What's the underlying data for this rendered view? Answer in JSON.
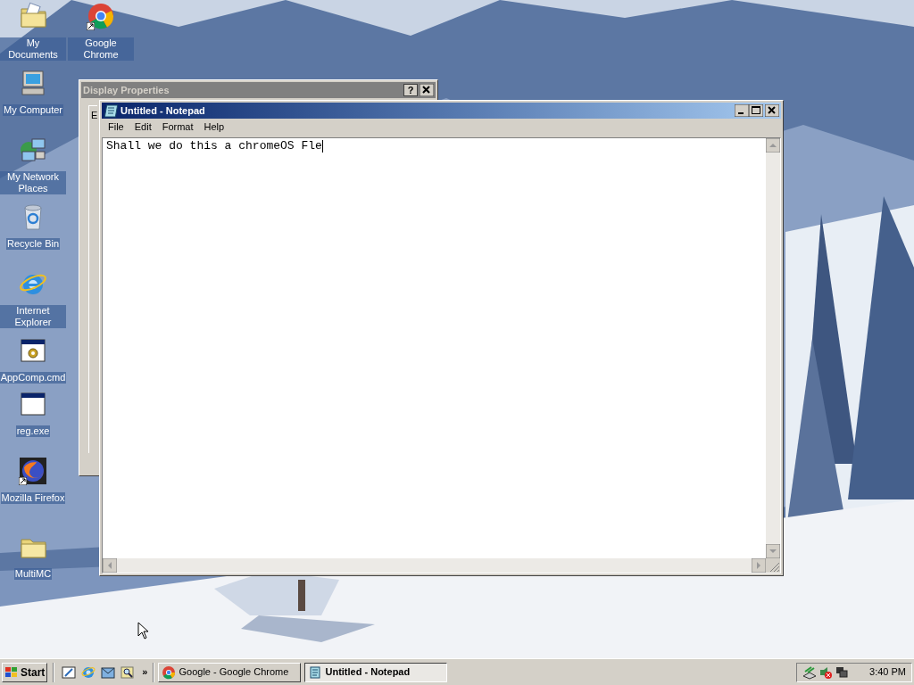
{
  "desktop_icons": [
    {
      "label": "My Documents",
      "kind": "folder-docs"
    },
    {
      "label": "Google Chrome",
      "kind": "chrome",
      "shortcut": true
    },
    {
      "label": "My Computer",
      "kind": "computer"
    },
    {
      "label": "My Network Places",
      "kind": "network"
    },
    {
      "label": "Recycle Bin",
      "kind": "recycle"
    },
    {
      "label": "Internet Explorer",
      "kind": "ie"
    },
    {
      "label": "AppComp.cmd",
      "kind": "cmd"
    },
    {
      "label": "reg.exe",
      "kind": "exe"
    },
    {
      "label": "Mozilla Firefox",
      "kind": "firefox",
      "shortcut": true
    },
    {
      "label": "MultiMC",
      "kind": "folder"
    }
  ],
  "background_window": {
    "title": "Display Properties",
    "active": false,
    "help_button": "?",
    "tab_label": "E"
  },
  "notepad": {
    "title": "Untitled - Notepad",
    "active": true,
    "menu": [
      "File",
      "Edit",
      "Format",
      "Help"
    ],
    "text": "Shall we do this a chromeOS Fle"
  },
  "taskbar": {
    "start": "Start",
    "overflow": "»",
    "tasks": [
      {
        "label": "Google - Google Chrome",
        "selected": false
      },
      {
        "label": "Untitled - Notepad",
        "selected": true
      }
    ],
    "clock": "3:40 PM"
  }
}
